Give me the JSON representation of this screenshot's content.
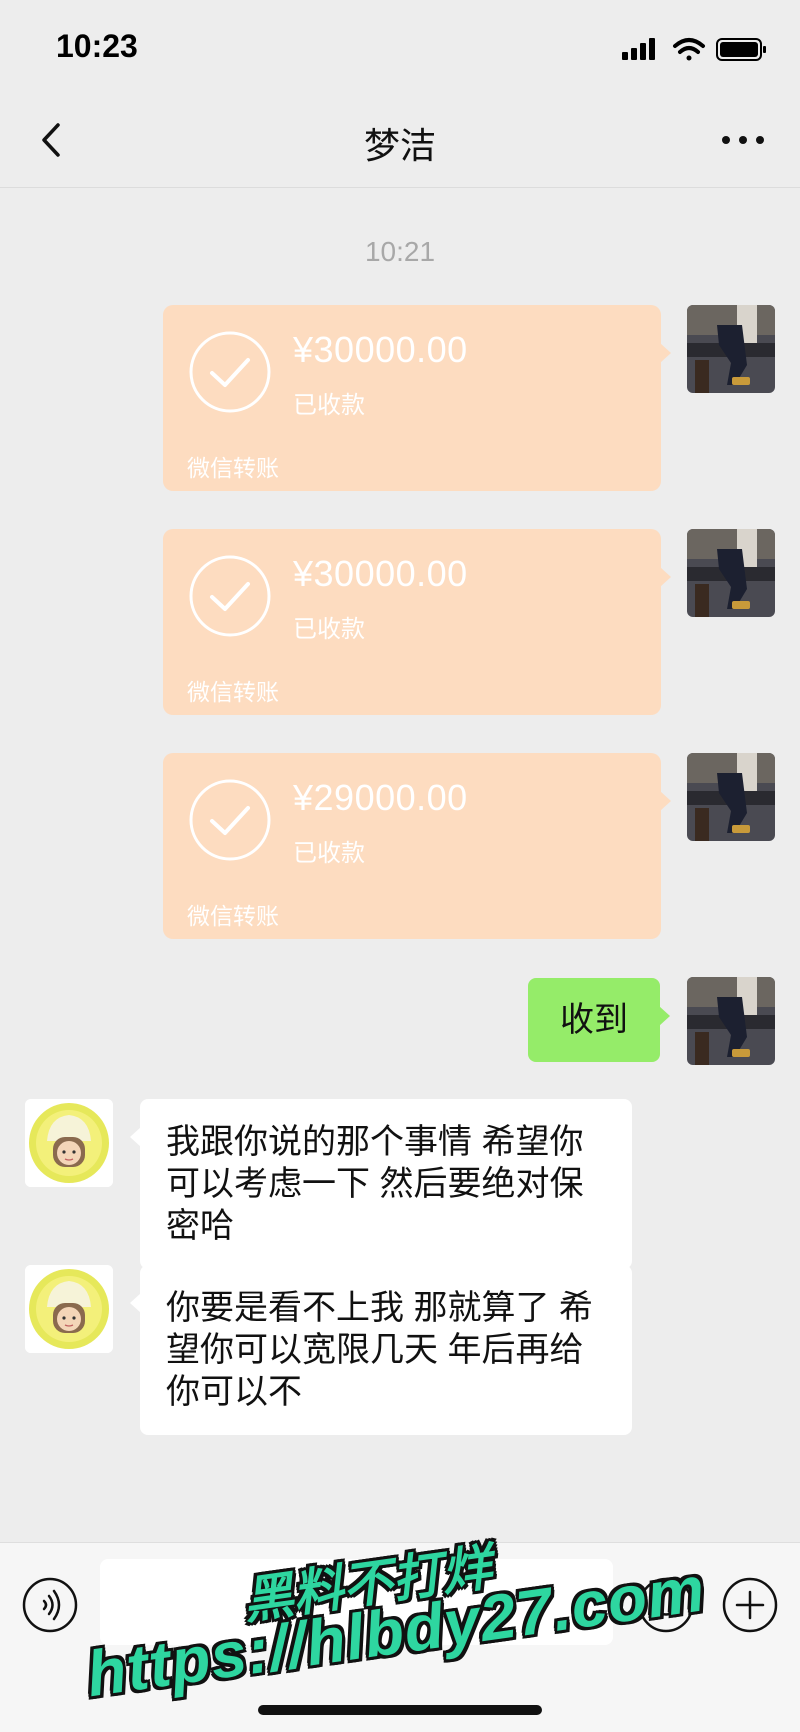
{
  "status_bar": {
    "time": "10:23"
  },
  "header": {
    "title": "梦洁"
  },
  "chat": {
    "timestamp": "10:21",
    "transfers": [
      {
        "amount": "¥30000.00",
        "status": "已收款",
        "label": "微信转账"
      },
      {
        "amount": "¥30000.00",
        "status": "已收款",
        "label": "微信转账"
      },
      {
        "amount": "¥29000.00",
        "status": "已收款",
        "label": "微信转账"
      }
    ],
    "sent_text": "收到",
    "received": [
      {
        "text": "我跟你说的那个事情 希望你可以考虑一下 然后要绝对保密哈"
      },
      {
        "text": " 你要是看不上我 那就算了 希望你可以宽限几天 年后再给你可以不"
      }
    ]
  },
  "input": {
    "placeholder": ""
  },
  "watermark": {
    "line1": "黑料不打烊",
    "line2": "https://hlbdy27.com"
  },
  "colors": {
    "transfer_bg": "#fddcc0",
    "sent_bubble": "#95ec69",
    "background": "#ededed",
    "watermark": "#2ed6a0"
  }
}
